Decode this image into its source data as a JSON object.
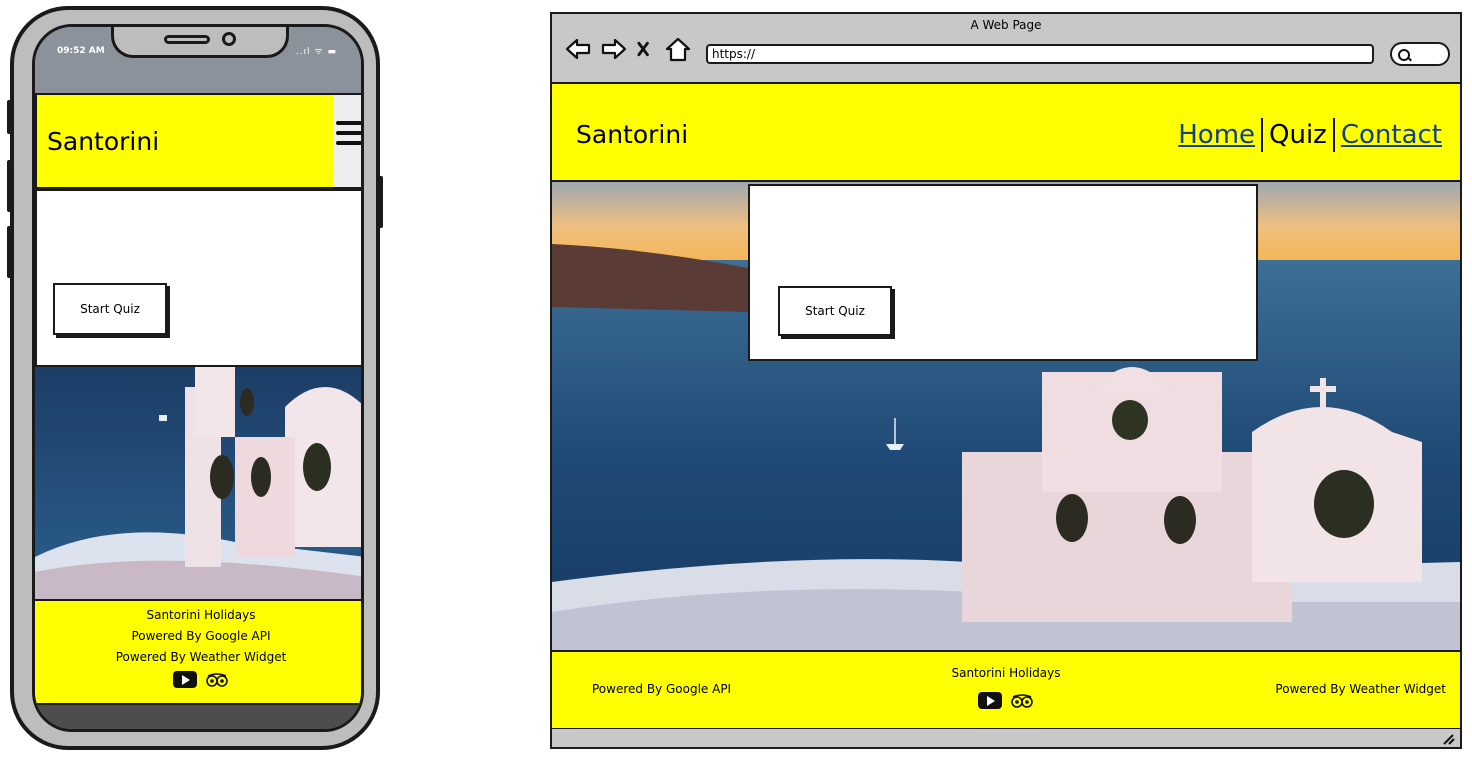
{
  "mobile": {
    "status": {
      "time": "09:52 AM",
      "icons": "..ıl ᯤ ▬"
    },
    "site_title": "Santorini",
    "quiz": {
      "start_label": "Start Quiz"
    },
    "footer": {
      "brand": "Santorini Holidays",
      "powered_google": "Powered By Google API",
      "powered_weather": "Powered By Weather Widget"
    }
  },
  "browser": {
    "window_title": "A Web Page",
    "url": "https://",
    "site_title": "Santorini",
    "nav": {
      "home": "Home",
      "quiz": "Quiz",
      "contact": "Contact"
    },
    "quiz": {
      "start_label": "Start Quiz"
    },
    "footer": {
      "brand": "Santorini Holidays",
      "powered_google": "Powered By Google API",
      "powered_weather": "Powered By Weather Widget"
    }
  },
  "colors": {
    "header_yellow": "#ffff00",
    "nav_link": "#123f8a",
    "frame": "#1a1a1a"
  },
  "icons": [
    "back-arrow-icon",
    "forward-arrow-icon",
    "close-x-icon",
    "home-icon",
    "search-icon",
    "hamburger-icon",
    "youtube-icon",
    "tripadvisor-icon"
  ]
}
